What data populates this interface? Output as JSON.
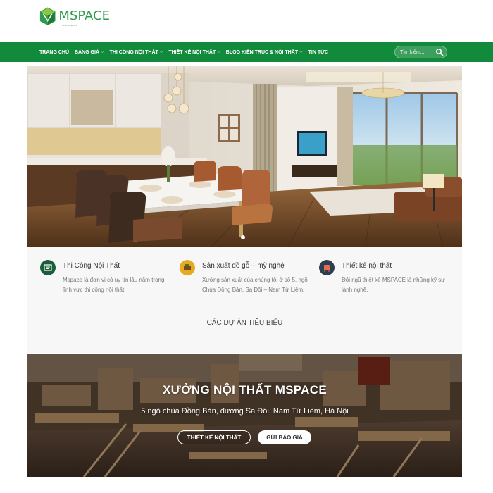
{
  "brand": {
    "name": "MSPACE",
    "tagline": "MSPACE.VN",
    "color": "#2f9a4a"
  },
  "nav": {
    "background": "#128a3b",
    "items": [
      {
        "label": "TRANG CHỦ",
        "dropdown": false
      },
      {
        "label": "BẢNG GIÁ",
        "dropdown": true
      },
      {
        "label": "THI CÔNG NỘI THẤT",
        "dropdown": true
      },
      {
        "label": "THIẾT KẾ NỘI THẤT",
        "dropdown": true
      },
      {
        "label": "BLOG KIẾN TRÚC & NỘI THẤT",
        "dropdown": true
      },
      {
        "label": "TIN TỨC",
        "dropdown": false
      }
    ],
    "chevron": "⌵",
    "search": {
      "placeholder": "Tìm kiếm...",
      "icon": "search-icon"
    }
  },
  "hero": {
    "slides": 1,
    "active_slide": 1
  },
  "features": [
    {
      "title": "Thi Công Nội Thất",
      "desc": "Mspace là đơn vị có uy tín lâu năm trong lĩnh vực thi công nội thất",
      "icon": "construction-icon",
      "icon_bg": "#1b5e3b"
    },
    {
      "title": "Sản xuất đồ gỗ – mỹ nghệ",
      "desc": "Xưởng sản xuất của chúng tôi ở số 5, ngõ Chùa Đồng Bản, Sa Đôi – Nam Từ Liêm.",
      "icon": "furniture-icon",
      "icon_bg": "#e6a91f"
    },
    {
      "title": "Thiết kế nội thất",
      "desc": "Đội ngũ thiết kế MSPACE là những kỹ sư lành nghề.",
      "icon": "chair-icon",
      "icon_bg": "#2c3e50"
    }
  ],
  "section": {
    "title": "CÁC DỰ ÁN TIÊU BIỂU"
  },
  "banner": {
    "title": "XƯỞNG NỘI THẤT MSPACE",
    "subtitle": "5 ngõ chùa Đồng Bàn, đường Sa Đôi, Nam Từ Liêm, Hà Nội",
    "button_design": "THIẾT KẾ NỘI THẤT",
    "button_quote": "GỬI BÁO GIÁ"
  }
}
